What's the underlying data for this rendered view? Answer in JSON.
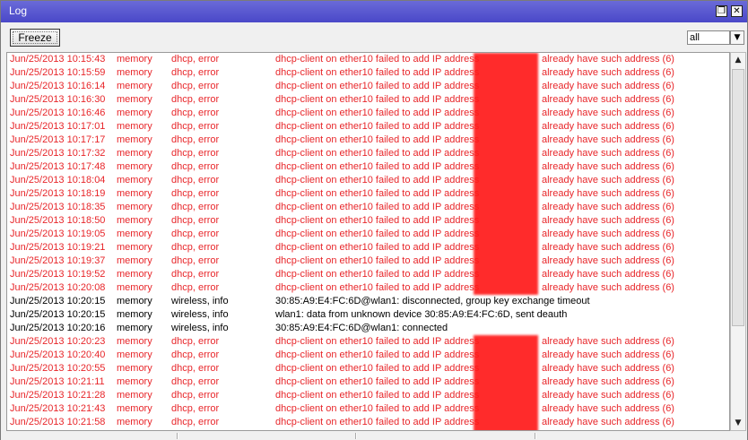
{
  "window": {
    "title": "Log"
  },
  "toolbar": {
    "freeze_label": "Freeze",
    "filter_value": "all"
  },
  "colors": {
    "error": "#e8262a",
    "info": "#000000",
    "titlebar": "#4a48c8"
  },
  "log_rows": [
    {
      "time": "Jun/25/2013 10:15:43",
      "buffer": "memory",
      "topics": "dhcp, error",
      "message": "dhcp-client on ether10 failed to add IP address",
      "message_end": "already have such address (6)",
      "level": "error"
    },
    {
      "time": "Jun/25/2013 10:15:59",
      "buffer": "memory",
      "topics": "dhcp, error",
      "message": "dhcp-client on ether10 failed to add IP address",
      "message_end": "already have such address (6)",
      "level": "error"
    },
    {
      "time": "Jun/25/2013 10:16:14",
      "buffer": "memory",
      "topics": "dhcp, error",
      "message": "dhcp-client on ether10 failed to add IP address",
      "message_end": "already have such address (6)",
      "level": "error"
    },
    {
      "time": "Jun/25/2013 10:16:30",
      "buffer": "memory",
      "topics": "dhcp, error",
      "message": "dhcp-client on ether10 failed to add IP address",
      "message_end": "already have such address (6)",
      "level": "error"
    },
    {
      "time": "Jun/25/2013 10:16:46",
      "buffer": "memory",
      "topics": "dhcp, error",
      "message": "dhcp-client on ether10 failed to add IP address",
      "message_end": "already have such address (6)",
      "level": "error"
    },
    {
      "time": "Jun/25/2013 10:17:01",
      "buffer": "memory",
      "topics": "dhcp, error",
      "message": "dhcp-client on ether10 failed to add IP address",
      "message_end": "already have such address (6)",
      "level": "error"
    },
    {
      "time": "Jun/25/2013 10:17:17",
      "buffer": "memory",
      "topics": "dhcp, error",
      "message": "dhcp-client on ether10 failed to add IP address",
      "message_end": "already have such address (6)",
      "level": "error"
    },
    {
      "time": "Jun/25/2013 10:17:32",
      "buffer": "memory",
      "topics": "dhcp, error",
      "message": "dhcp-client on ether10 failed to add IP address",
      "message_end": "already have such address (6)",
      "level": "error"
    },
    {
      "time": "Jun/25/2013 10:17:48",
      "buffer": "memory",
      "topics": "dhcp, error",
      "message": "dhcp-client on ether10 failed to add IP address",
      "message_end": "already have such address (6)",
      "level": "error"
    },
    {
      "time": "Jun/25/2013 10:18:04",
      "buffer": "memory",
      "topics": "dhcp, error",
      "message": "dhcp-client on ether10 failed to add IP address",
      "message_end": "already have such address (6)",
      "level": "error"
    },
    {
      "time": "Jun/25/2013 10:18:19",
      "buffer": "memory",
      "topics": "dhcp, error",
      "message": "dhcp-client on ether10 failed to add IP address",
      "message_end": "already have such address (6)",
      "level": "error"
    },
    {
      "time": "Jun/25/2013 10:18:35",
      "buffer": "memory",
      "topics": "dhcp, error",
      "message": "dhcp-client on ether10 failed to add IP address",
      "message_end": "already have such address (6)",
      "level": "error"
    },
    {
      "time": "Jun/25/2013 10:18:50",
      "buffer": "memory",
      "topics": "dhcp, error",
      "message": "dhcp-client on ether10 failed to add IP address",
      "message_end": "already have such address (6)",
      "level": "error"
    },
    {
      "time": "Jun/25/2013 10:19:05",
      "buffer": "memory",
      "topics": "dhcp, error",
      "message": "dhcp-client on ether10 failed to add IP address",
      "message_end": "already have such address (6)",
      "level": "error"
    },
    {
      "time": "Jun/25/2013 10:19:21",
      "buffer": "memory",
      "topics": "dhcp, error",
      "message": "dhcp-client on ether10 failed to add IP address",
      "message_end": "already have such address (6)",
      "level": "error"
    },
    {
      "time": "Jun/25/2013 10:19:37",
      "buffer": "memory",
      "topics": "dhcp, error",
      "message": "dhcp-client on ether10 failed to add IP address",
      "message_end": "already have such address (6)",
      "level": "error"
    },
    {
      "time": "Jun/25/2013 10:19:52",
      "buffer": "memory",
      "topics": "dhcp, error",
      "message": "dhcp-client on ether10 failed to add IP address",
      "message_end": "already have such address (6)",
      "level": "error"
    },
    {
      "time": "Jun/25/2013 10:20:08",
      "buffer": "memory",
      "topics": "dhcp, error",
      "message": "dhcp-client on ether10 failed to add IP address",
      "message_end": "already have such address (6)",
      "level": "error"
    },
    {
      "time": "Jun/25/2013 10:20:15",
      "buffer": "memory",
      "topics": "wireless, info",
      "message": "30:85:A9:E4:FC:6D@wlan1: disconnected, group key exchange timeout",
      "message_end": "",
      "level": "info"
    },
    {
      "time": "Jun/25/2013 10:20:15",
      "buffer": "memory",
      "topics": "wireless, info",
      "message": "wlan1: data from unknown device 30:85:A9:E4:FC:6D, sent deauth",
      "message_end": "",
      "level": "info"
    },
    {
      "time": "Jun/25/2013 10:20:16",
      "buffer": "memory",
      "topics": "wireless, info",
      "message": "30:85:A9:E4:FC:6D@wlan1: connected",
      "message_end": "",
      "level": "info"
    },
    {
      "time": "Jun/25/2013 10:20:23",
      "buffer": "memory",
      "topics": "dhcp, error",
      "message": "dhcp-client on ether10 failed to add IP address",
      "message_end": "already have such address (6)",
      "level": "error"
    },
    {
      "time": "Jun/25/2013 10:20:40",
      "buffer": "memory",
      "topics": "dhcp, error",
      "message": "dhcp-client on ether10 failed to add IP address",
      "message_end": "already have such address (6)",
      "level": "error"
    },
    {
      "time": "Jun/25/2013 10:20:55",
      "buffer": "memory",
      "topics": "dhcp, error",
      "message": "dhcp-client on ether10 failed to add IP address",
      "message_end": "already have such address (6)",
      "level": "error"
    },
    {
      "time": "Jun/25/2013 10:21:11",
      "buffer": "memory",
      "topics": "dhcp, error",
      "message": "dhcp-client on ether10 failed to add IP address",
      "message_end": "already have such address (6)",
      "level": "error"
    },
    {
      "time": "Jun/25/2013 10:21:28",
      "buffer": "memory",
      "topics": "dhcp, error",
      "message": "dhcp-client on ether10 failed to add IP address",
      "message_end": "already have such address (6)",
      "level": "error"
    },
    {
      "time": "Jun/25/2013 10:21:43",
      "buffer": "memory",
      "topics": "dhcp, error",
      "message": "dhcp-client on ether10 failed to add IP address",
      "message_end": "already have such address (6)",
      "level": "error"
    },
    {
      "time": "Jun/25/2013 10:21:58",
      "buffer": "memory",
      "topics": "dhcp, error",
      "message": "dhcp-client on ether10 failed to add IP address",
      "message_end": "already have such address (6)",
      "level": "error"
    }
  ],
  "icons": {
    "restore": "restore-icon",
    "close": "close-icon",
    "dropdown": "dropdown-arrow-icon",
    "scroll_up": "scroll-up-icon",
    "scroll_down": "scroll-down-icon"
  }
}
